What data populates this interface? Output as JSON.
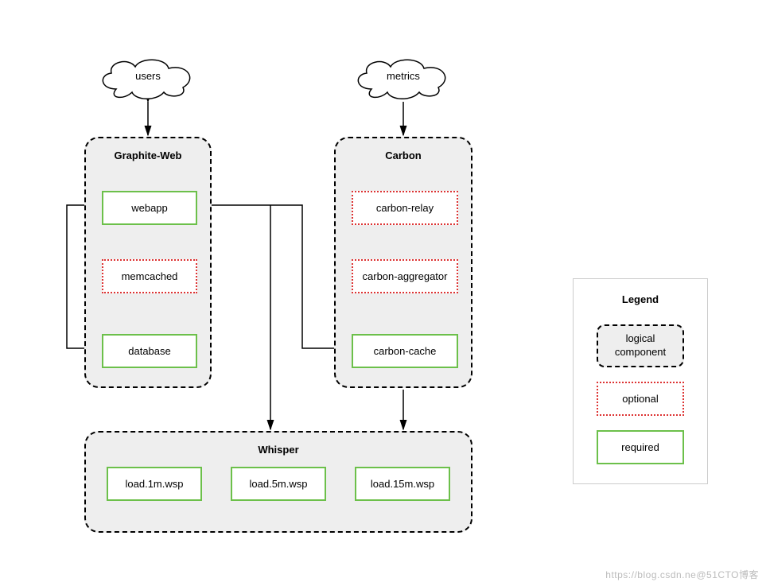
{
  "clouds": {
    "users": "users",
    "metrics": "metrics"
  },
  "groups": {
    "graphite_web": {
      "title": "Graphite-Web",
      "webapp": "webapp",
      "memcached": "memcached",
      "database": "database"
    },
    "carbon": {
      "title": "Carbon",
      "relay": "carbon-relay",
      "aggregator": "carbon-aggregator",
      "cache": "carbon-cache"
    },
    "whisper": {
      "title": "Whisper",
      "files": [
        "load.1m.wsp",
        "load.5m.wsp",
        "load.15m.wsp"
      ]
    }
  },
  "legend": {
    "title": "Legend",
    "logical": "logical component",
    "optional": "optional",
    "required": "required"
  },
  "watermark": "https://blog.csdn.ne@51CTO博客"
}
